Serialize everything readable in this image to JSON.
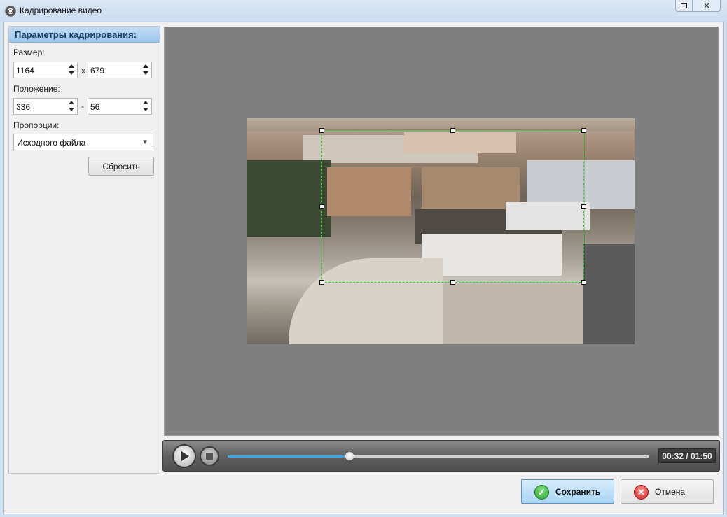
{
  "window": {
    "title": "Кадрирование видео"
  },
  "panel": {
    "header": "Параметры кадрирования:",
    "size_label": "Размер:",
    "width": "1164",
    "size_sep": "x",
    "height": "679",
    "position_label": "Положение:",
    "pos_x": "336",
    "pos_sep": "-",
    "pos_y": "56",
    "proportions_label": "Пропорции:",
    "proportions_value": "Исходного файла",
    "reset_label": "Сбросить"
  },
  "player": {
    "progress": 0.29,
    "time": "00:32 / 01:50"
  },
  "buttons": {
    "save_label": "Сохранить",
    "cancel_label": "Отмена"
  },
  "icons": {
    "window": "film-reel-icon",
    "play": "play-icon",
    "stop": "stop-icon",
    "save": "checkmark-icon",
    "cancel": "close-icon"
  },
  "colors": {
    "crop_border": "#22dd22",
    "progress_fill": "#39a6ea",
    "panel_header": "#9dc6ec",
    "save_button": "#a9d3f2"
  }
}
